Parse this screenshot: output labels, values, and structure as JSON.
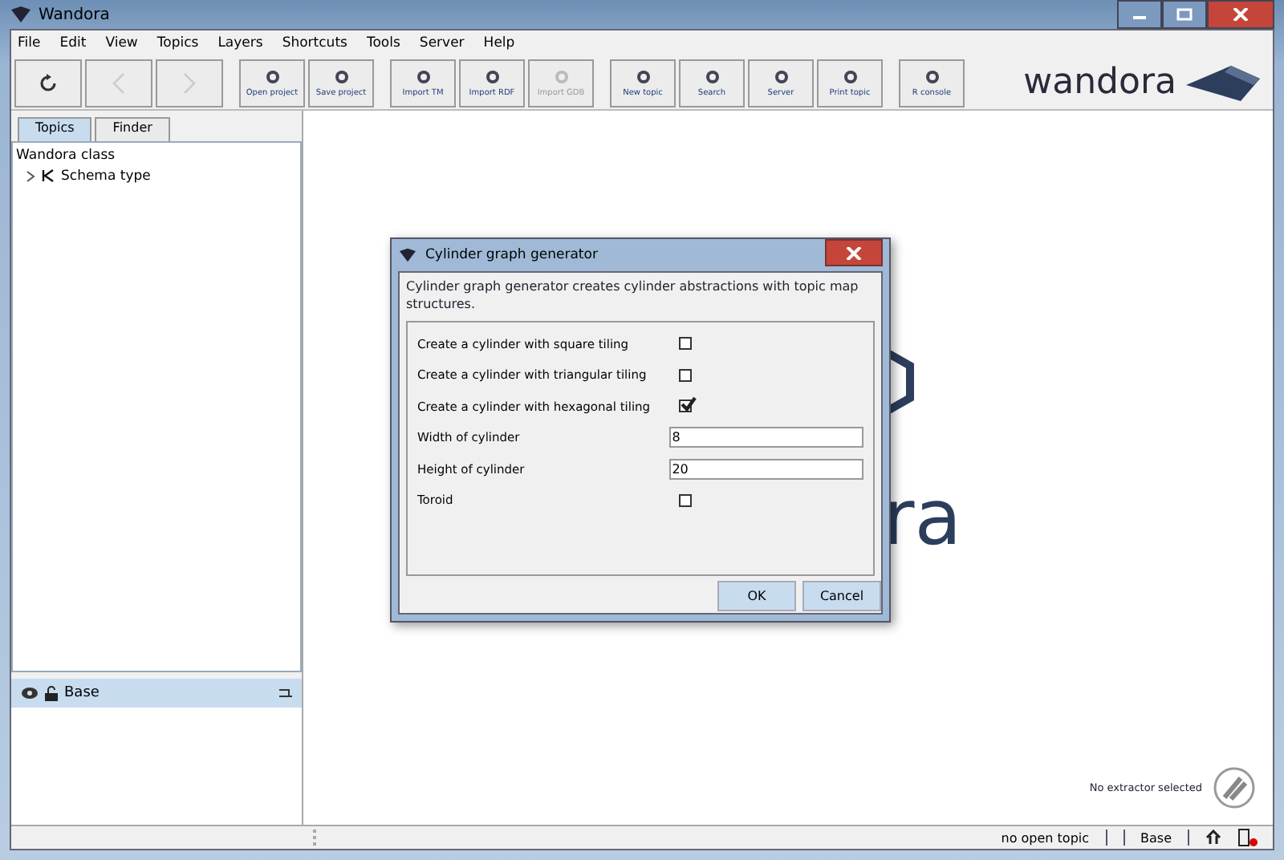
{
  "window": {
    "title": "Wandora"
  },
  "menu": [
    "File",
    "Edit",
    "View",
    "Topics",
    "Layers",
    "Shortcuts",
    "Tools",
    "Server",
    "Help"
  ],
  "toolbar": [
    {
      "kind": "nav",
      "disabled": false
    },
    {
      "kind": "nav",
      "disabled": true
    },
    {
      "kind": "nav",
      "disabled": true
    },
    {
      "kind": "tool",
      "label": "Open project",
      "disabled": false
    },
    {
      "kind": "tool",
      "label": "Save project",
      "disabled": false
    },
    {
      "kind": "tool",
      "label": "Import TM",
      "disabled": false
    },
    {
      "kind": "tool",
      "label": "Import RDF",
      "disabled": false
    },
    {
      "kind": "tool",
      "label": "Import GDB",
      "disabled": true
    },
    {
      "kind": "tool",
      "label": "New topic",
      "disabled": false
    },
    {
      "kind": "tool",
      "label": "Search",
      "disabled": false
    },
    {
      "kind": "tool",
      "label": "Server",
      "disabled": false
    },
    {
      "kind": "tool",
      "label": "Print topic",
      "disabled": false
    },
    {
      "kind": "tool",
      "label": "R console",
      "disabled": false
    }
  ],
  "logo": "wandora",
  "tabs": [
    {
      "label": "Topics",
      "selected": true
    },
    {
      "label": "Finder",
      "selected": false
    }
  ],
  "tree": {
    "label": "Wandora class",
    "children": [
      {
        "label": "Schema type",
        "expanded": false
      }
    ]
  },
  "layers": {
    "label": "Base"
  },
  "background_logo": "ra",
  "extractor": {
    "label": "No extractor selected"
  },
  "dialog": {
    "title": "Cylinder graph generator",
    "description": "Cylinder graph generator creates cylinder abstractions with topic map structures.",
    "fields": [
      {
        "kind": "checkbox",
        "label": "Create a cylinder with square tiling",
        "checked": false
      },
      {
        "kind": "checkbox",
        "label": "Create a cylinder with triangular tiling",
        "checked": false
      },
      {
        "kind": "checkbox",
        "label": "Create a cylinder with hexagonal tiling",
        "checked": true
      },
      {
        "kind": "text",
        "label": "Width of cylinder",
        "value": "8"
      },
      {
        "kind": "text",
        "label": "Height of cylinder",
        "value": "20"
      },
      {
        "kind": "checkbox",
        "label": "Toroid",
        "checked": false
      }
    ],
    "buttons": [
      "OK",
      "Cancel"
    ]
  },
  "status_bar": {
    "topic": "no open topic",
    "layer": "Base"
  }
}
